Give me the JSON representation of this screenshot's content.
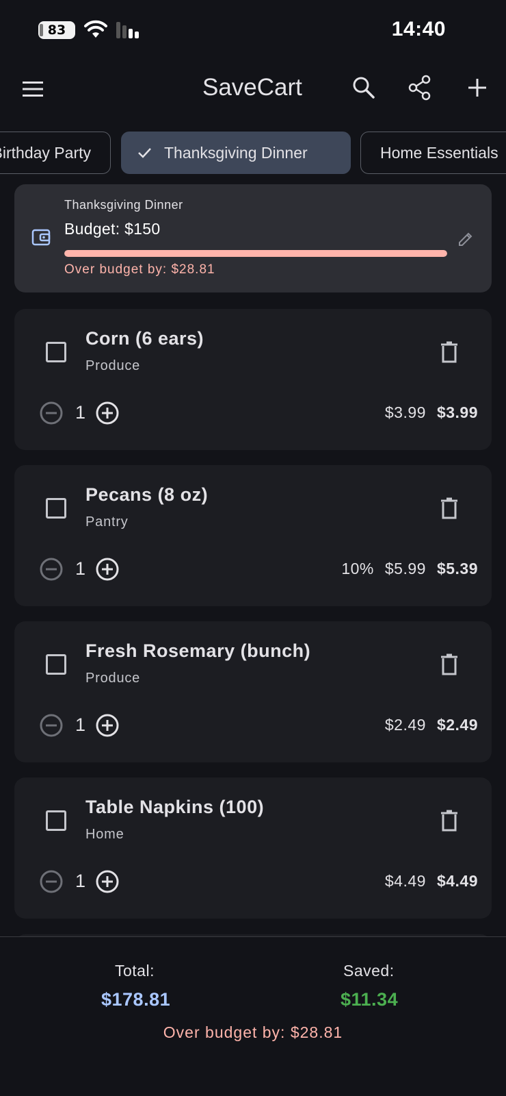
{
  "status_bar": {
    "battery": "83",
    "time": "14:40"
  },
  "app_bar": {
    "title": "SaveCart",
    "icons": [
      "menu-icon",
      "search-icon",
      "share-icon",
      "plus-icon"
    ]
  },
  "chips": [
    {
      "label": "Birthday Party",
      "selected": false
    },
    {
      "label": "Thanksgiving Dinner",
      "selected": true
    },
    {
      "label": "Home Essentials",
      "selected": false
    }
  ],
  "budget": {
    "list_name": "Thanksgiving Dinner",
    "title": "Budget: $150",
    "progress": 1.0,
    "over_text": "Over budget by: $28.81"
  },
  "items": [
    {
      "name": "Corn (6 ears)",
      "category": "Produce",
      "qty": "1",
      "discount": "",
      "price": "$3.99",
      "final": "$3.99"
    },
    {
      "name": "Pecans (8 oz)",
      "category": "Pantry",
      "qty": "1",
      "discount": "10%",
      "price": "$5.99",
      "final": "$5.39"
    },
    {
      "name": "Fresh Rosemary (bunch)",
      "category": "Produce",
      "qty": "1",
      "discount": "",
      "price": "$2.49",
      "final": "$2.49"
    },
    {
      "name": "Table Napkins (100)",
      "category": "Home",
      "qty": "1",
      "discount": "",
      "price": "$4.49",
      "final": "$4.49"
    }
  ],
  "footer": {
    "total_label": "Total:",
    "total_value": "$178.81",
    "saved_label": "Saved:",
    "saved_value": "$11.34",
    "over_text": "Over budget by: $28.81"
  },
  "colors": {
    "background": "#121318",
    "accent": "#aac7ff",
    "error": "#ffb4ab",
    "saved": "#4caf50",
    "chip_selected": "#3e4759"
  }
}
